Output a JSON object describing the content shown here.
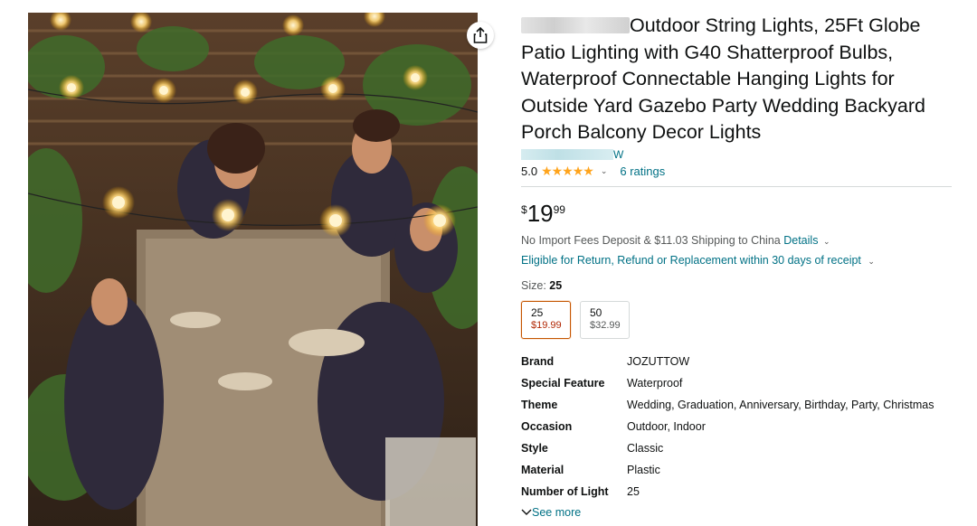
{
  "product": {
    "title": "Outdoor String Lights, 25Ft Globe Patio Lighting with G40 Shatterproof Bulbs, Waterproof Connectable Hanging Lights for Outside Yard Gazebo Party Wedding Backyard Porch Balcony Decor Lights",
    "store_suffix": "W",
    "rating_value": "5.0",
    "stars": "★★★★★",
    "ratings_count": "6 ratings",
    "price_symbol": "$",
    "price_whole": "19",
    "price_fraction": "99",
    "shipping_text": "No Import Fees Deposit & $11.03 Shipping to China",
    "shipping_details_link": "Details",
    "return_text": "Eligible for Return, Refund or Replacement within 30 days of receipt",
    "size_label": "Size:",
    "size_selected": "25",
    "sizes": [
      {
        "label": "25",
        "price": "$19.99"
      },
      {
        "label": "50",
        "price": "$32.99"
      }
    ],
    "attributes": [
      {
        "key": "Brand",
        "value": "JOZUTTOW"
      },
      {
        "key": "Special Feature",
        "value": "Waterproof"
      },
      {
        "key": "Theme",
        "value": "Wedding, Graduation, Anniversary, Birthday, Party, Christmas"
      },
      {
        "key": "Occasion",
        "value": "Outdoor, Indoor"
      },
      {
        "key": "Style",
        "value": "Classic"
      },
      {
        "key": "Material",
        "value": "Plastic"
      },
      {
        "key": "Number of Light",
        "value": "25"
      }
    ],
    "see_more": "See more"
  },
  "icons": {
    "share": "share-icon",
    "chevron": "chevron-down-icon"
  },
  "colors": {
    "link": "#007185",
    "star": "#ffa41c",
    "selected_border": "#c45500",
    "selected_price": "#b12704"
  }
}
